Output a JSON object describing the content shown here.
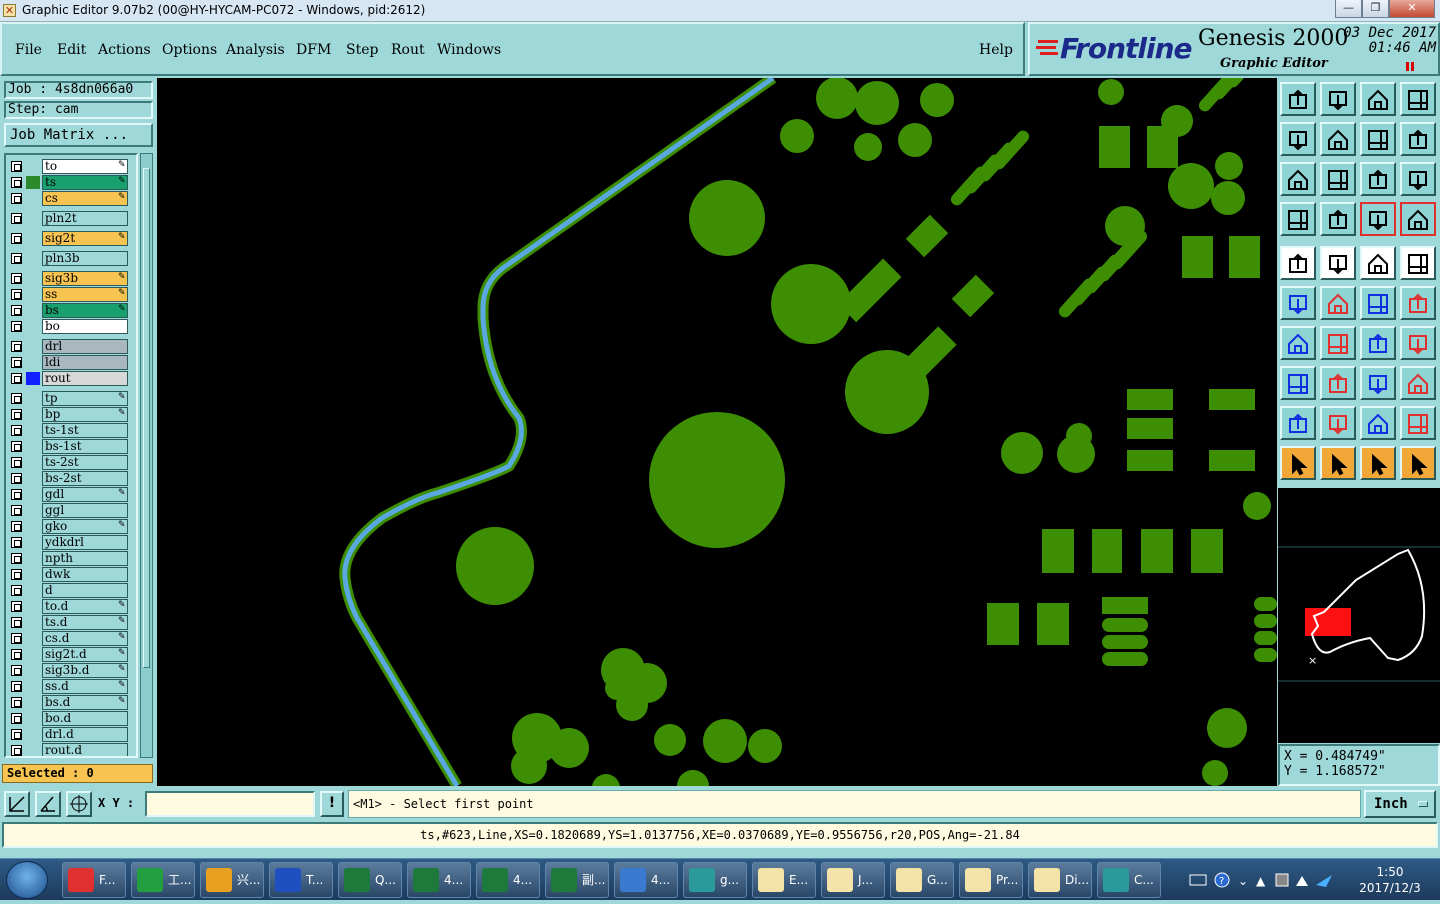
{
  "window": {
    "title": "Graphic Editor 9.07b2 (00@HY-HYCAM-PC072 - Windows, pid:2612)",
    "controls": {
      "minimize": "—",
      "maximize": "❐",
      "close": "✕"
    }
  },
  "menu": {
    "items": [
      "File",
      "Edit",
      "Actions",
      "Options",
      "Analysis",
      "DFM",
      "Step",
      "Rout",
      "Windows"
    ],
    "help": "Help"
  },
  "brand": {
    "logo": "Frontline",
    "product": "Genesis 2000",
    "subtitle": "Graphic Editor",
    "date": "03 Dec 2017",
    "time": "01:46 AM"
  },
  "job": {
    "job_label": "Job : 4s8dn066a0",
    "step_label": "Step: cam",
    "matrix_button": "Job Matrix ..."
  },
  "layers": [
    {
      "name": "to",
      "color": "#ffffff",
      "editable": true,
      "swatch": ""
    },
    {
      "name": "ts",
      "color": "#1aa06e",
      "editable": true,
      "swatch": "#2c8a2c",
      "active": true
    },
    {
      "name": "cs",
      "color": "#f7c451",
      "editable": true,
      "swatch": ""
    },
    {
      "name": "pln2t",
      "color": "#9fd8d8",
      "editable": false,
      "swatch": ""
    },
    {
      "name": "sig2t",
      "color": "#f7c451",
      "editable": true,
      "swatch": ""
    },
    {
      "name": "pln3b",
      "color": "#9fd8d8",
      "editable": false,
      "swatch": ""
    },
    {
      "name": "sig3b",
      "color": "#f7c451",
      "editable": true,
      "swatch": ""
    },
    {
      "name": "ss",
      "color": "#f7c451",
      "editable": true,
      "swatch": ""
    },
    {
      "name": "bs",
      "color": "#1aa06e",
      "editable": true,
      "swatch": ""
    },
    {
      "name": "bo",
      "color": "#ffffff",
      "editable": false,
      "swatch": ""
    },
    {
      "name": "drl",
      "color": "#a9b8bf",
      "editable": false,
      "swatch": ""
    },
    {
      "name": "ldi",
      "color": "#a9b8bf",
      "editable": false,
      "swatch": ""
    },
    {
      "name": "rout",
      "color": "#d8d8d8",
      "editable": false,
      "swatch": "#1020ff"
    },
    {
      "name": "tp",
      "color": "#9fd8d8",
      "editable": true,
      "swatch": ""
    },
    {
      "name": "bp",
      "color": "#9fd8d8",
      "editable": true,
      "swatch": ""
    },
    {
      "name": "ts-1st",
      "color": "#9fd8d8",
      "editable": false,
      "swatch": ""
    },
    {
      "name": "bs-1st",
      "color": "#9fd8d8",
      "editable": false,
      "swatch": ""
    },
    {
      "name": "ts-2st",
      "color": "#9fd8d8",
      "editable": false,
      "swatch": ""
    },
    {
      "name": "bs-2st",
      "color": "#9fd8d8",
      "editable": false,
      "swatch": ""
    },
    {
      "name": "gdl",
      "color": "#9fd8d8",
      "editable": true,
      "swatch": ""
    },
    {
      "name": "ggl",
      "color": "#9fd8d8",
      "editable": false,
      "swatch": ""
    },
    {
      "name": "gko",
      "color": "#9fd8d8",
      "editable": true,
      "swatch": ""
    },
    {
      "name": "ydkdrl",
      "color": "#9fd8d8",
      "editable": false,
      "swatch": ""
    },
    {
      "name": "npth",
      "color": "#9fd8d8",
      "editable": false,
      "swatch": ""
    },
    {
      "name": "dwk",
      "color": "#9fd8d8",
      "editable": false,
      "swatch": ""
    },
    {
      "name": "d",
      "color": "#9fd8d8",
      "editable": false,
      "swatch": ""
    },
    {
      "name": "to.d",
      "color": "#9fd8d8",
      "editable": true,
      "swatch": ""
    },
    {
      "name": "ts.d",
      "color": "#9fd8d8",
      "editable": true,
      "swatch": ""
    },
    {
      "name": "cs.d",
      "color": "#9fd8d8",
      "editable": true,
      "swatch": ""
    },
    {
      "name": "sig2t.d",
      "color": "#9fd8d8",
      "editable": true,
      "swatch": ""
    },
    {
      "name": "sig3b.d",
      "color": "#9fd8d8",
      "editable": true,
      "swatch": ""
    },
    {
      "name": "ss.d",
      "color": "#9fd8d8",
      "editable": true,
      "swatch": ""
    },
    {
      "name": "bs.d",
      "color": "#9fd8d8",
      "editable": true,
      "swatch": ""
    },
    {
      "name": "bo.d",
      "color": "#9fd8d8",
      "editable": false,
      "swatch": ""
    },
    {
      "name": "drl.d",
      "color": "#9fd8d8",
      "editable": false,
      "swatch": ""
    },
    {
      "name": "rout.d",
      "color": "#9fd8d8",
      "editable": false,
      "swatch": ""
    }
  ],
  "selection": {
    "label": "Selected : 0"
  },
  "canvas": {
    "copper_color": "#3e8e04",
    "trace_color": "#5aa8e0",
    "background": "#000000"
  },
  "toolbar": {
    "icons": [
      "home-up-icon",
      "home-down-icon",
      "house-icon",
      "window-icon",
      "pan-left-icon",
      "pan-right-icon",
      "mirror-icon",
      "redraw-icon",
      "fit-icon",
      "zoom-fit-icon",
      "scale-icon",
      "query-icon",
      "measure-icon",
      "pin-icon",
      "net-icon",
      "net-alt-icon",
      "pad-icon",
      "polygon-icon",
      "ruler-icon",
      "circle-icon",
      "nodes-icon",
      "cut-icon",
      "connect-icon",
      "move-icon",
      "angle-icon",
      "line-icon",
      "arc-icon",
      "flip-icon",
      "copy-icon",
      "split-icon",
      "align-icon",
      "group-icon",
      "triangle-icon",
      "triangle-up-icon",
      "arch-icon",
      "arch-alt-icon",
      "pointer-icon",
      "select-box-icon",
      "select-circle-icon",
      "select-net-icon"
    ]
  },
  "cursor": {
    "x_label": "X = 0.484749\"",
    "y_label": "Y = 1.168572\""
  },
  "command": {
    "xy_label": "X Y :",
    "xy_value": "",
    "prompt": "<M1> - Select first point",
    "units": "Inch",
    "bang": "!"
  },
  "status": {
    "text": "ts,#623,Line,XS=0.1820689,YS=1.0137756,XE=0.0370689,YE=0.9556756,r20,POS,Ang=-21.84"
  },
  "taskbar": {
    "items": [
      {
        "label": "F...",
        "color": "#e03030"
      },
      {
        "label": "工...",
        "color": "#22a040"
      },
      {
        "label": "兴...",
        "color": "#e8a020"
      },
      {
        "label": "T...",
        "color": "#2050c0"
      },
      {
        "label": "Q...",
        "color": "#1e7a3a"
      },
      {
        "label": "4...",
        "color": "#1e7a3a"
      },
      {
        "label": "4...",
        "color": "#1e7a3a"
      },
      {
        "label": "副...",
        "color": "#1e7a3a"
      },
      {
        "label": "4...",
        "color": "#3a7ad0"
      },
      {
        "label": "g...",
        "color": "#2a9a9a"
      },
      {
        "label": "E...",
        "color": "#f4e3a8"
      },
      {
        "label": "J...",
        "color": "#f4e3a8"
      },
      {
        "label": "G...",
        "color": "#f4e3a8"
      },
      {
        "label": "Pr...",
        "color": "#f4e3a8"
      },
      {
        "label": "Di...",
        "color": "#f4e3a8"
      },
      {
        "label": "C...",
        "color": "#2a9a9a"
      }
    ],
    "time": "1:50",
    "date": "2017/12/3"
  }
}
